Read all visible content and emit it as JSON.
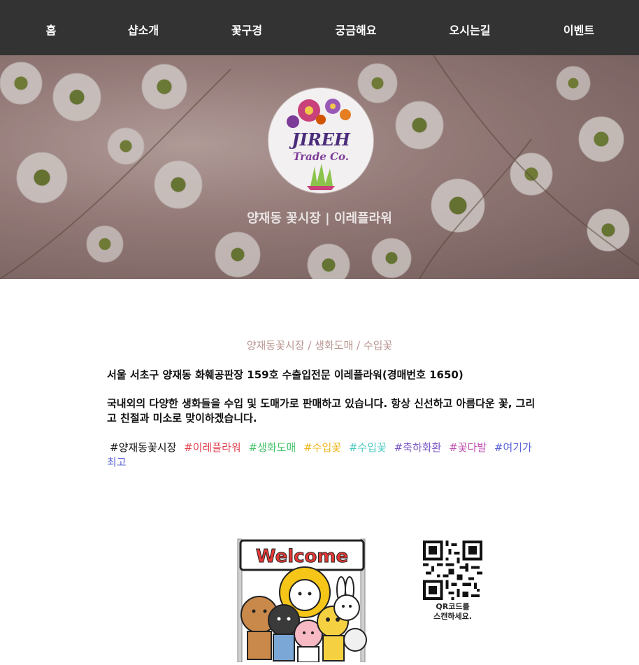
{
  "nav": {
    "items": [
      "홈",
      "샵소개",
      "꽃구경",
      "궁금해요",
      "오시는길",
      "이벤트"
    ]
  },
  "hero": {
    "title": "양재동 꽃시장 | 이레플라워",
    "logo": {
      "line1": "JIREH",
      "line2": "Trade Co."
    }
  },
  "content": {
    "subtitle": "양재동꽃시장 / 생화도매 / 수입꽃",
    "address": "서울 서초구 양재동 화훼공판장 159호 수출입전문 이레플라워(경매번호 1650)",
    "description": "국내외의 다양한 생화들을 수입 및 도매가로 판매하고 있습니다. 항상 신선하고 아름다운 꽃, 그리고 친절과 미소로 맞이하겠습니다.",
    "tags": [
      {
        "text": "#양재동꽃시장",
        "color": "#111111"
      },
      {
        "text": "#이레플라워",
        "color": "#e0414f"
      },
      {
        "text": "#생화도매",
        "color": "#46c46b"
      },
      {
        "text": "#수입꽃",
        "color": "#f0b51d"
      },
      {
        "text": "#수입꽃",
        "color": "#4cc9c0"
      },
      {
        "text": "#축하화환",
        "color": "#7a57c4"
      },
      {
        "text": "#꽃다발",
        "color": "#c04fb1"
      },
      {
        "text": "#여기가최고",
        "color": "#5a64d6"
      }
    ]
  },
  "footer": {
    "welcome_sign": "Welcome",
    "qr_caption_line1": "QR코드를",
    "qr_caption_line2": "스캔하세요."
  },
  "colors": {
    "nav_bg": "#333333",
    "subtitle": "#b89690"
  }
}
